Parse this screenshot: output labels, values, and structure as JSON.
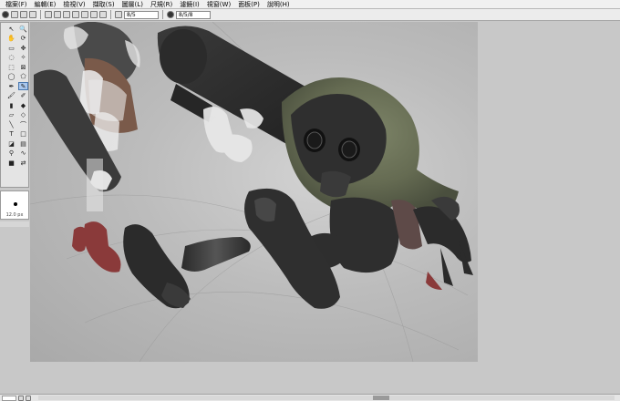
{
  "menu": [
    {
      "label": "檔案(F)"
    },
    {
      "label": "編輯(E)"
    },
    {
      "label": "檢視(V)"
    },
    {
      "label": "擷取(S)"
    },
    {
      "label": "圖層(L)"
    },
    {
      "label": "尺規(R)"
    },
    {
      "label": "濾鏡(I)"
    },
    {
      "label": "視窗(W)"
    },
    {
      "label": "面板(P)"
    },
    {
      "label": "說明(H)"
    }
  ],
  "toolbar": {
    "field1": "8/5",
    "field2": "8/5/8"
  },
  "tools": [
    {
      "name": "pointer",
      "glyph": "↖"
    },
    {
      "name": "zoom",
      "glyph": "🔍"
    },
    {
      "name": "hand",
      "glyph": "✋"
    },
    {
      "name": "rotate",
      "glyph": "⟳"
    },
    {
      "name": "select-rect",
      "glyph": "▭"
    },
    {
      "name": "move",
      "glyph": "✥"
    },
    {
      "name": "select-lasso",
      "glyph": "◌"
    },
    {
      "name": "select-wand",
      "glyph": "✧"
    },
    {
      "name": "marquee",
      "glyph": "⬚"
    },
    {
      "name": "crop",
      "glyph": "⊠"
    },
    {
      "name": "ellipse",
      "glyph": "◯"
    },
    {
      "name": "polygon",
      "glyph": "⬠"
    },
    {
      "name": "pen",
      "glyph": "✒"
    },
    {
      "name": "pencil",
      "glyph": "✎"
    },
    {
      "name": "brush",
      "glyph": "🖌"
    },
    {
      "name": "airbrush",
      "glyph": "✐"
    },
    {
      "name": "marker",
      "glyph": "▮"
    },
    {
      "name": "watercolor",
      "glyph": "◆"
    },
    {
      "name": "eraser",
      "glyph": "▱"
    },
    {
      "name": "blur",
      "glyph": "◇"
    },
    {
      "name": "line",
      "glyph": "╲"
    },
    {
      "name": "curve",
      "glyph": "⌒"
    },
    {
      "name": "text",
      "glyph": "T"
    },
    {
      "name": "rect-shape",
      "glyph": "□"
    },
    {
      "name": "bucket",
      "glyph": "◪"
    },
    {
      "name": "gradient",
      "glyph": "▤"
    },
    {
      "name": "eyedropper",
      "glyph": "⚲"
    },
    {
      "name": "smudge",
      "glyph": "∿"
    },
    {
      "name": "fg-bg-color",
      "glyph": "■"
    },
    {
      "name": "color-swap",
      "glyph": "⇄"
    }
  ],
  "brush": {
    "size_label": "12.0 px"
  },
  "colors": {
    "canvas_bg": "#b8b8b8",
    "hood": "#6b7158",
    "body_dark": "#2e2e2e",
    "shoes_red": "#8a3a3a",
    "skin_brown": "#7a5a4a"
  }
}
